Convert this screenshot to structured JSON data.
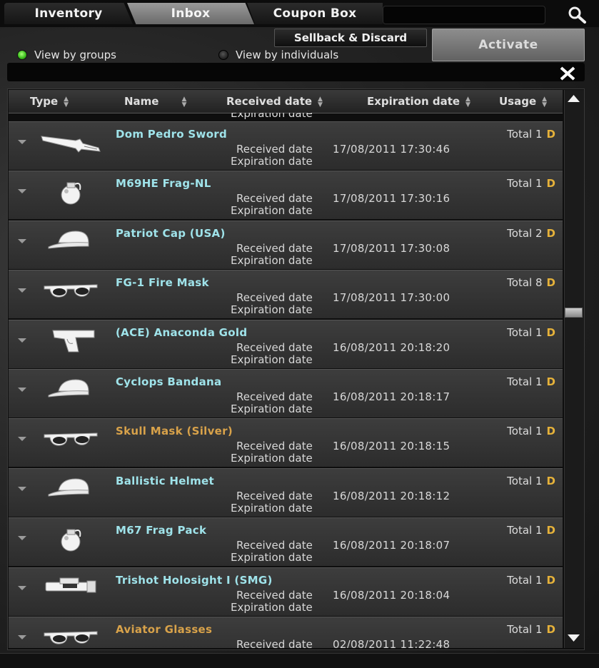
{
  "tabs": [
    {
      "label": "Inventory"
    },
    {
      "label": "Inbox"
    },
    {
      "label": "Coupon Box"
    }
  ],
  "search": {
    "placeholder": "",
    "value": ""
  },
  "buttons": {
    "sellback": "Sellback & Discard",
    "activate": "Activate"
  },
  "view_options": {
    "groups": "View by groups",
    "individuals": "View by individuals",
    "selected": "groups"
  },
  "columns": [
    "Type",
    "Name",
    "Received date",
    "Expiration date",
    "Usage"
  ],
  "labels": {
    "received": "Received date",
    "expiration": "Expiration date",
    "total": "Total",
    "d": "D"
  },
  "items": [
    {
      "icon": "knife-icon",
      "name": "Dom Pedro Sword",
      "received": "17/08/2011  17:30:46",
      "total": "1",
      "color": "cyan"
    },
    {
      "icon": "grenade-icon",
      "name": "M69HE Frag-NL",
      "received": "17/08/2011  17:30:16",
      "total": "1",
      "color": "cyan"
    },
    {
      "icon": "cap-icon",
      "name": "Patriot Cap (USA)",
      "received": "17/08/2011  17:30:08",
      "total": "2",
      "color": "cyan"
    },
    {
      "icon": "glasses-icon",
      "name": "FG-1 Fire Mask",
      "received": "17/08/2011  17:30:00",
      "total": "8",
      "color": "cyan"
    },
    {
      "icon": "pistol-icon",
      "name": "(ACE) Anaconda Gold",
      "received": "16/08/2011  20:18:20",
      "total": "1",
      "color": "cyan"
    },
    {
      "icon": "cap-icon",
      "name": "Cyclops Bandana",
      "received": "16/08/2011  20:18:17",
      "total": "1",
      "color": "cyan"
    },
    {
      "icon": "glasses-icon",
      "name": "Skull Mask (Silver)",
      "received": "16/08/2011  20:18:15",
      "total": "1",
      "color": "gold"
    },
    {
      "icon": "cap-icon",
      "name": "Ballistic Helmet",
      "received": "16/08/2011  20:18:12",
      "total": "1",
      "color": "cyan"
    },
    {
      "icon": "grenade-icon",
      "name": "M67 Frag Pack",
      "received": "16/08/2011  20:18:07",
      "total": "1",
      "color": "cyan"
    },
    {
      "icon": "scope-icon",
      "name": "Trishot Holosight I (SMG)",
      "received": "16/08/2011  20:18:04",
      "total": "1",
      "color": "cyan"
    },
    {
      "icon": "glasses-icon",
      "name": "Aviator Glasses",
      "received": "02/08/2011  11:22:48",
      "total": "1",
      "color": "gold"
    }
  ],
  "colors": {
    "name_cyan": "#9fe3ea",
    "name_gold": "#d8a24a",
    "usage_d": "#e6b23a",
    "radio_active": "#3dbf1e"
  }
}
